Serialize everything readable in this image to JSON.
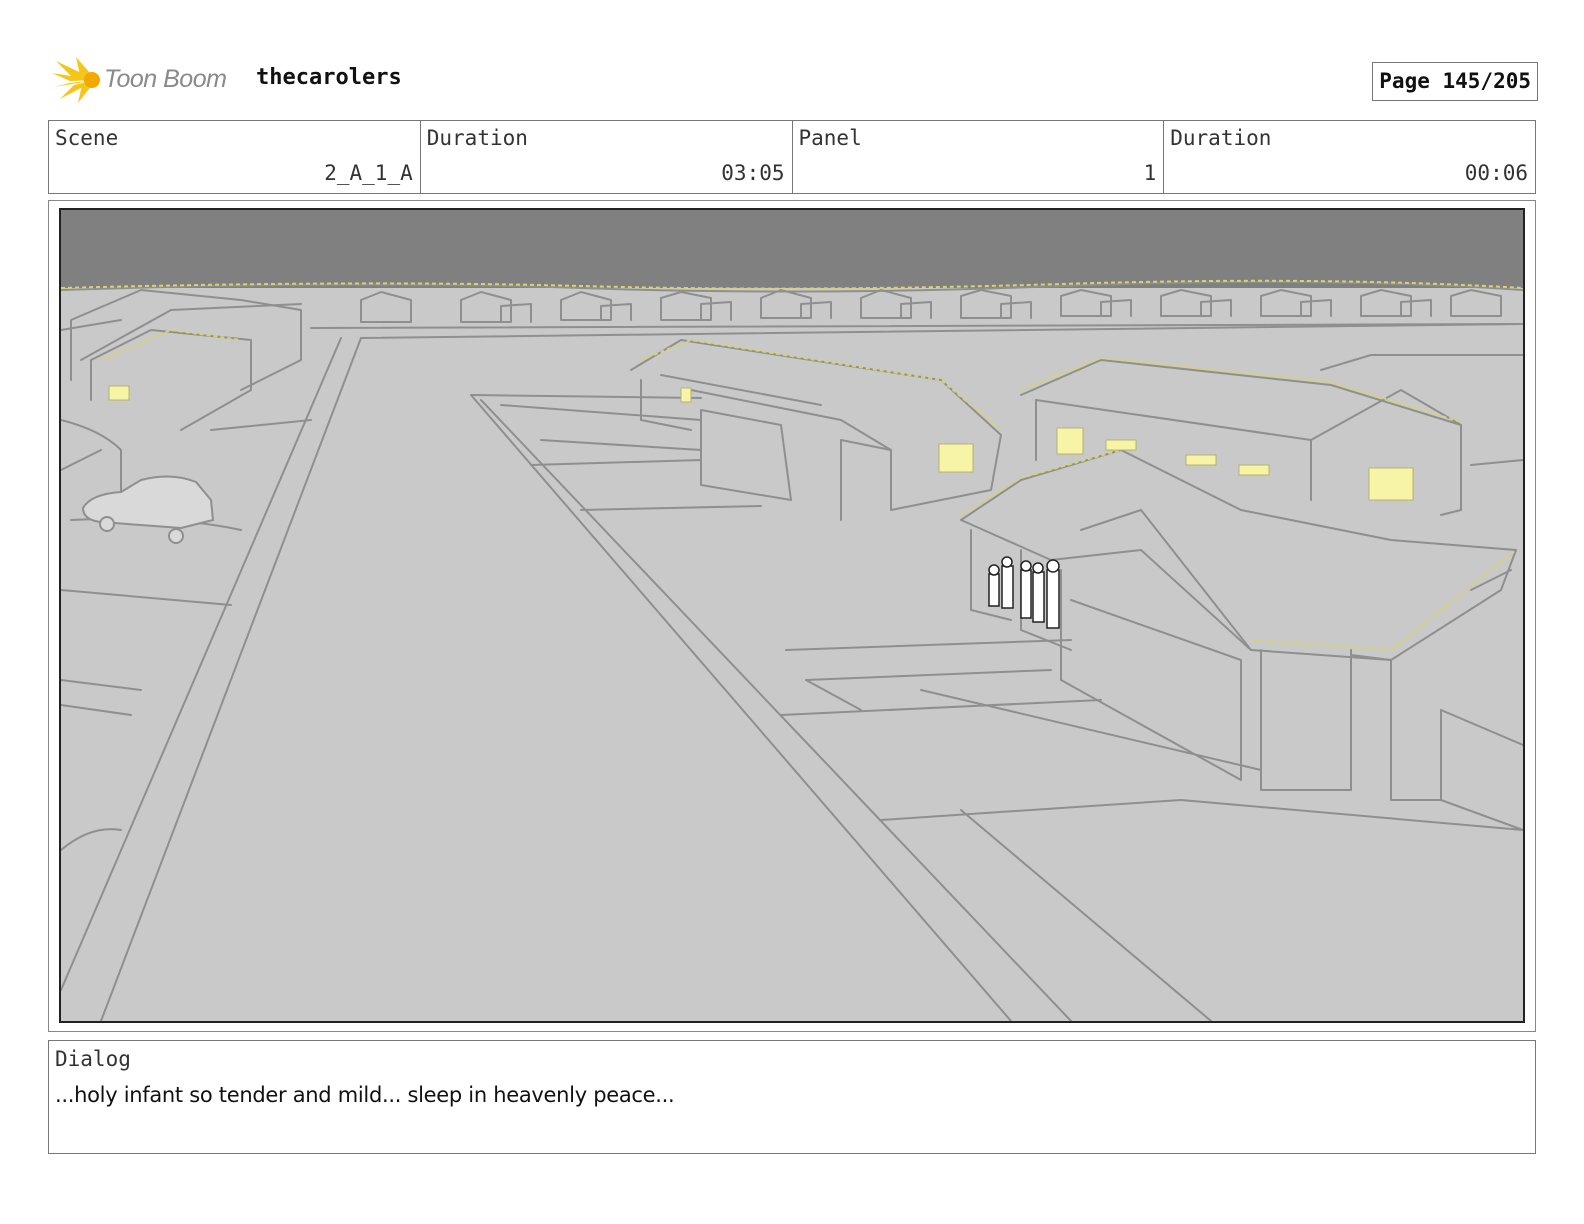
{
  "header": {
    "brand": "Toon Boom",
    "project": "thecarolers",
    "page": "Page 145/205"
  },
  "info": {
    "scene_label": "Scene",
    "scene_value": "2_A_1_A",
    "scene_duration_label": "Duration",
    "scene_duration_value": "03:05",
    "panel_label": "Panel",
    "panel_value": "1",
    "panel_duration_label": "Duration",
    "panel_duration_value": "00:06"
  },
  "dialog": {
    "label": "Dialog",
    "text": "...holy infant so tender and mild... sleep in heavenly peace..."
  },
  "colors": {
    "sky": "#808080",
    "ground": "#c9c9c9",
    "line": "#8f8f8f",
    "window_light": "#f7f4a6",
    "logo_burst": "#f5c518"
  }
}
